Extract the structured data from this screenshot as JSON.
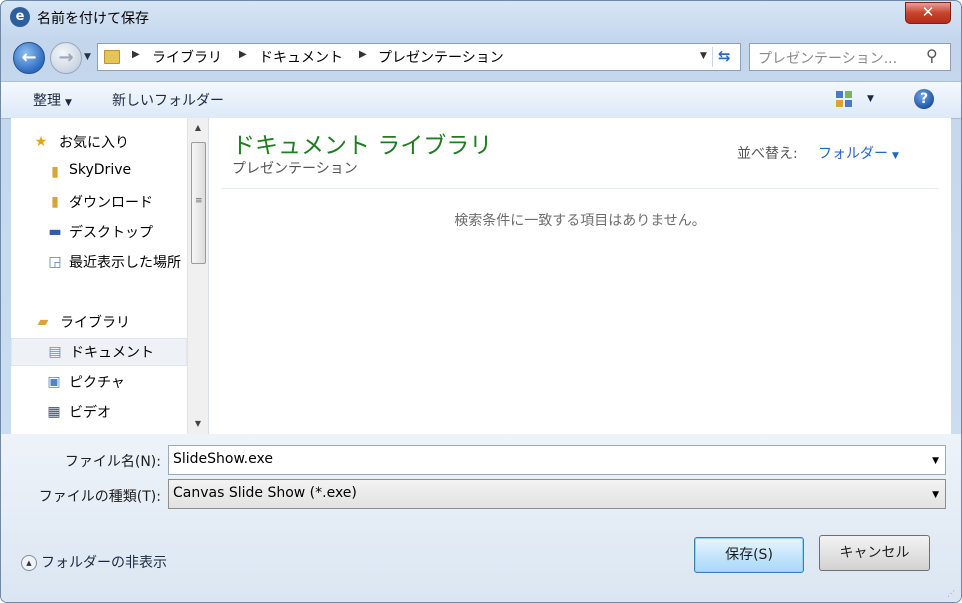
{
  "window": {
    "title": "名前を付けて保存",
    "close_glyph": "✕"
  },
  "navigation": {
    "back_glyph": "←",
    "forward_glyph": "→",
    "breadcrumbs": [
      "ライブラリ",
      "ドキュメント",
      "プレゼンテーション"
    ],
    "search_placeholder": "プレゼンテーション..."
  },
  "toolbar": {
    "organize_label": "整理",
    "new_folder_label": "新しいフォルダー",
    "help_glyph": "?"
  },
  "sidebar": {
    "favorites_label": "お気に入り",
    "favorites": [
      {
        "label": "SkyDrive",
        "icon": "skydrive-folder-icon"
      },
      {
        "label": "ダウンロード",
        "icon": "downloads-folder-icon"
      },
      {
        "label": "デスクトップ",
        "icon": "desktop-icon"
      },
      {
        "label": "最近表示した場所",
        "icon": "recent-places-icon"
      }
    ],
    "libraries_label": "ライブラリ",
    "libraries": [
      {
        "label": "ドキュメント",
        "icon": "documents-library-icon",
        "selected": true
      },
      {
        "label": "ピクチャ",
        "icon": "pictures-library-icon",
        "selected": false
      },
      {
        "label": "ビデオ",
        "icon": "videos-library-icon",
        "selected": false
      }
    ]
  },
  "content": {
    "library_title": "ドキュメント ライブラリ",
    "library_subtitle": "プレゼンテーション",
    "sort_label": "並べ替え:",
    "sort_value": "フォルダー",
    "empty_message": "検索条件に一致する項目はありません。"
  },
  "form": {
    "filename_label": "ファイル名(N):",
    "filename_value": "SlideShow.exe",
    "filetype_label": "ファイルの種類(T):",
    "filetype_value": "Canvas Slide Show (*.exe)",
    "hide_folders_label": "フォルダーの非表示",
    "save_label": "保存(S)",
    "cancel_label": "キャンセル"
  }
}
